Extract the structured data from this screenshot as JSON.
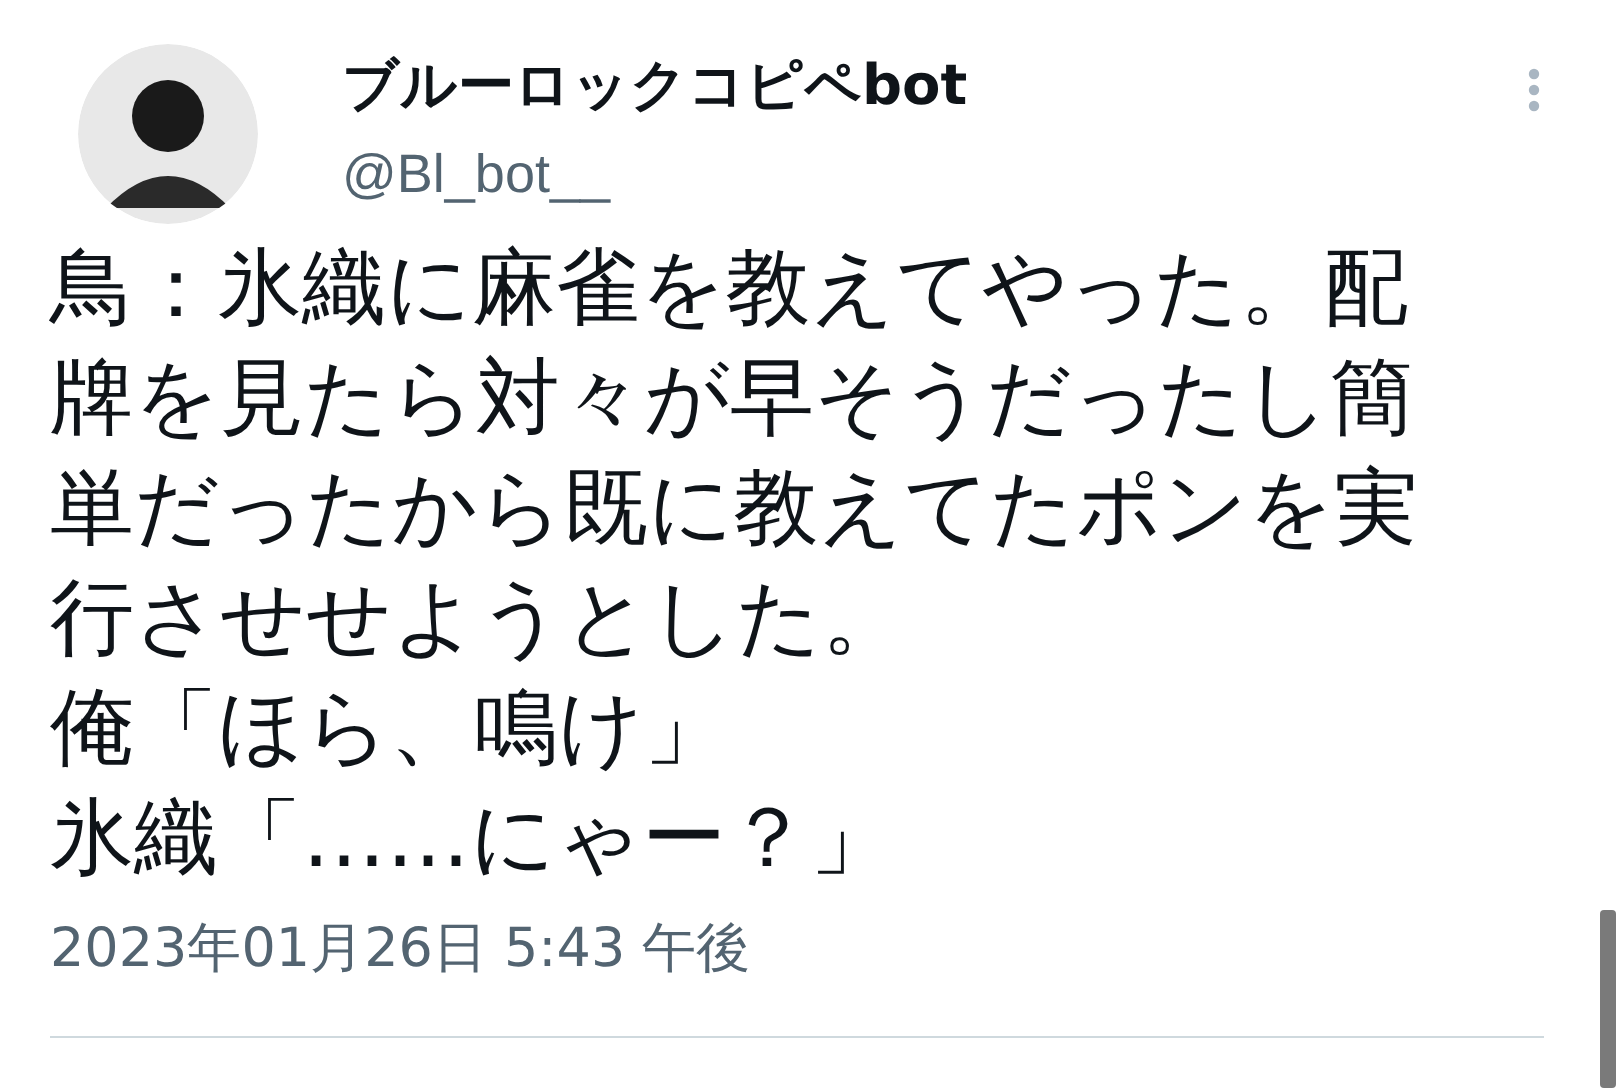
{
  "tweet": {
    "author": {
      "name": "ブルーロックコピペbot",
      "handle": "@Bl_bot__"
    },
    "paragraphs": [
      "鳥：氷織に麻雀を教えてやった。配牌を見たら対々が早そうだったし簡単だったから既に教えてたポンを実行させせようとした。",
      "俺「ほら、鳴け」",
      "氷織「……にゃー？」"
    ],
    "timestamp": "2023年01月26日 5:43 午後"
  }
}
